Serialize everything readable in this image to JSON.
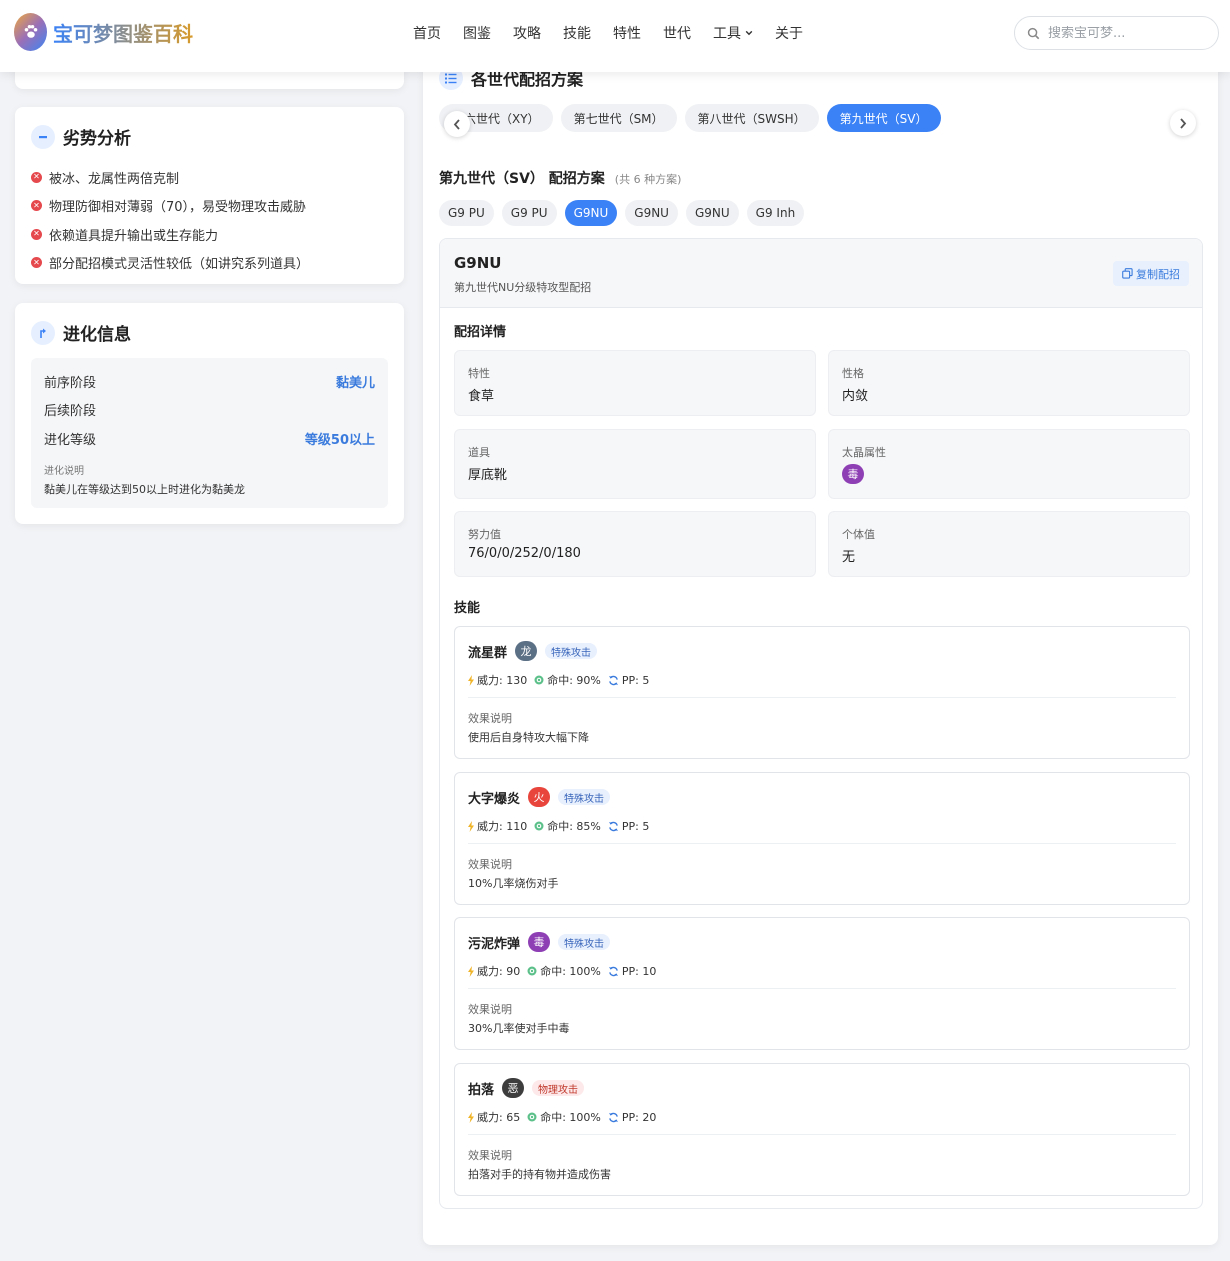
{
  "header": {
    "logo_text": "宝可梦图鉴百科",
    "nav": [
      "首页",
      "图鉴",
      "攻略",
      "技能",
      "特性",
      "世代",
      "工具",
      "关于"
    ],
    "search_placeholder": "搜索宝可梦..."
  },
  "weakness": {
    "title": "劣势分析",
    "items": [
      "被冰、龙属性两倍克制",
      "物理防御相对薄弱（70），易受物理攻击威胁",
      "依赖道具提升输出或生存能力",
      "部分配招模式灵活性较低（如讲究系列道具）"
    ]
  },
  "evolution": {
    "title": "进化信息",
    "prev_label": "前序阶段",
    "prev_value": "黏美儿",
    "next_label": "后续阶段",
    "next_value": "",
    "level_label": "进化等级",
    "level_value": "等级50以上",
    "note_label": "进化说明",
    "note_value": "黏美儿在等级达到50以上时进化为黏美龙"
  },
  "movesets": {
    "title": "各世代配招方案",
    "gen_tabs": [
      "第六世代（XY）",
      "第七世代（SM）",
      "第八世代（SWSH）",
      "第九世代（SV）"
    ],
    "active_gen": 3,
    "heading": "第九世代（SV） 配招方案",
    "count": "(共 6 种方案)",
    "set_tabs": [
      "G9 PU",
      "G9 PU",
      "G9NU",
      "G9NU",
      "G9NU",
      "G9 Inh"
    ],
    "active_set": 2,
    "set": {
      "name": "G9NU",
      "desc": "第九世代NU分级特攻型配招",
      "copy_label": "复制配招",
      "details_label": "配招详情",
      "ability_label": "特性",
      "ability": "食草",
      "nature_label": "性格",
      "nature": "内敛",
      "item_label": "道具",
      "item": "厚底靴",
      "tera_label": "太晶属性",
      "tera": "毒",
      "evs_label": "努力值",
      "evs": "76/0/0/252/0/180",
      "ivs_label": "个体值",
      "ivs": "无",
      "moves_label": "技能",
      "moves": [
        {
          "name": "流星群",
          "type": "龙",
          "type_color": "#5b6f85",
          "category": "特殊攻击",
          "power": "威力: 130",
          "acc": "命中: 90%",
          "pp": "PP: 5",
          "effect_label": "效果说明",
          "effect": "使用后自身特攻大幅下降"
        },
        {
          "name": "大字爆炎",
          "type": "火",
          "type_color": "#e8453c",
          "category": "特殊攻击",
          "power": "威力: 110",
          "acc": "命中: 85%",
          "pp": "PP: 5",
          "effect_label": "效果说明",
          "effect": "10%几率烧伤对手"
        },
        {
          "name": "污泥炸弹",
          "type": "毒",
          "type_color": "#8e3fb4",
          "category": "特殊攻击",
          "power": "威力: 90",
          "acc": "命中: 100%",
          "pp": "PP: 10",
          "effect_label": "效果说明",
          "effect": "30%几率使对手中毒"
        },
        {
          "name": "拍落",
          "type": "恶",
          "type_color": "#3d3d3d",
          "category": "物理攻击",
          "power": "威力: 65",
          "acc": "命中: 100%",
          "pp": "PP: 20",
          "effect_label": "效果说明",
          "effect": "拍落对手的持有物并造成伤害"
        }
      ]
    }
  }
}
